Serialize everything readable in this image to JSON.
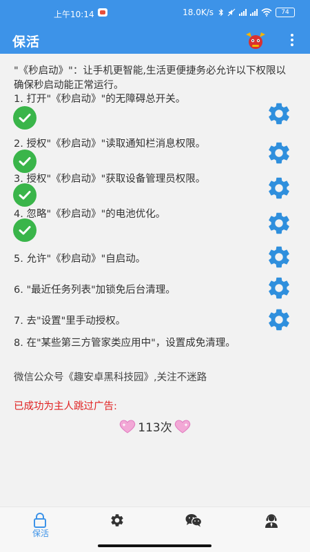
{
  "status_bar": {
    "time": "上午10:14",
    "network_speed": "18.0K/s",
    "battery": "74"
  },
  "app_bar": {
    "title": "保活",
    "menu_icon": "more-vert-icon",
    "mascot_icon": "mascot-icon"
  },
  "intro": {
    "text": "\"《秒启动》\"：让手机更智能,生活更便捷务必允许以下权限以确保秒启动能正常运行。"
  },
  "steps": [
    {
      "label": "1. 打开\"《秒启动》\"的无障碍总开关。",
      "granted": true
    },
    {
      "label": "2. 授权\"《秒启动》\"读取通知栏消息权限。",
      "granted": true
    },
    {
      "label": "3. 授权\"《秒启动》\"获取设备管理员权限。",
      "granted": true
    },
    {
      "label": "4. 忽略\"《秒启动》\"的电池优化。",
      "granted": true
    },
    {
      "label": "5. 允许\"《秒启动》\"自启动。",
      "granted": false
    },
    {
      "label": "6. \"最近任务列表\"加锁免后台清理。",
      "granted": false
    },
    {
      "label": "7. 去\"设置\"里手动授权。",
      "granted": false
    },
    {
      "label": "8. 在\"某些第三方管家类应用中\"，设置成免清理。",
      "granted": false
    }
  ],
  "wechat_note": "微信公众号《趣安卓黑科技园》,关注不迷路",
  "ad_skip_label": "已成功为主人跳过广告:",
  "ad_skip_count": "113次",
  "bottom_nav": [
    {
      "icon": "lock-icon",
      "label": "保活",
      "active": true
    },
    {
      "icon": "gear-icon",
      "label": "",
      "active": false
    },
    {
      "icon": "wechat-icon",
      "label": "",
      "active": false
    },
    {
      "icon": "support-agent-icon",
      "label": "",
      "active": false
    }
  ],
  "colors": {
    "primary": "#3d93e8",
    "check_green": "#3ab54a",
    "gear_blue": "#2f8fdd",
    "ad_red": "#e02020"
  }
}
